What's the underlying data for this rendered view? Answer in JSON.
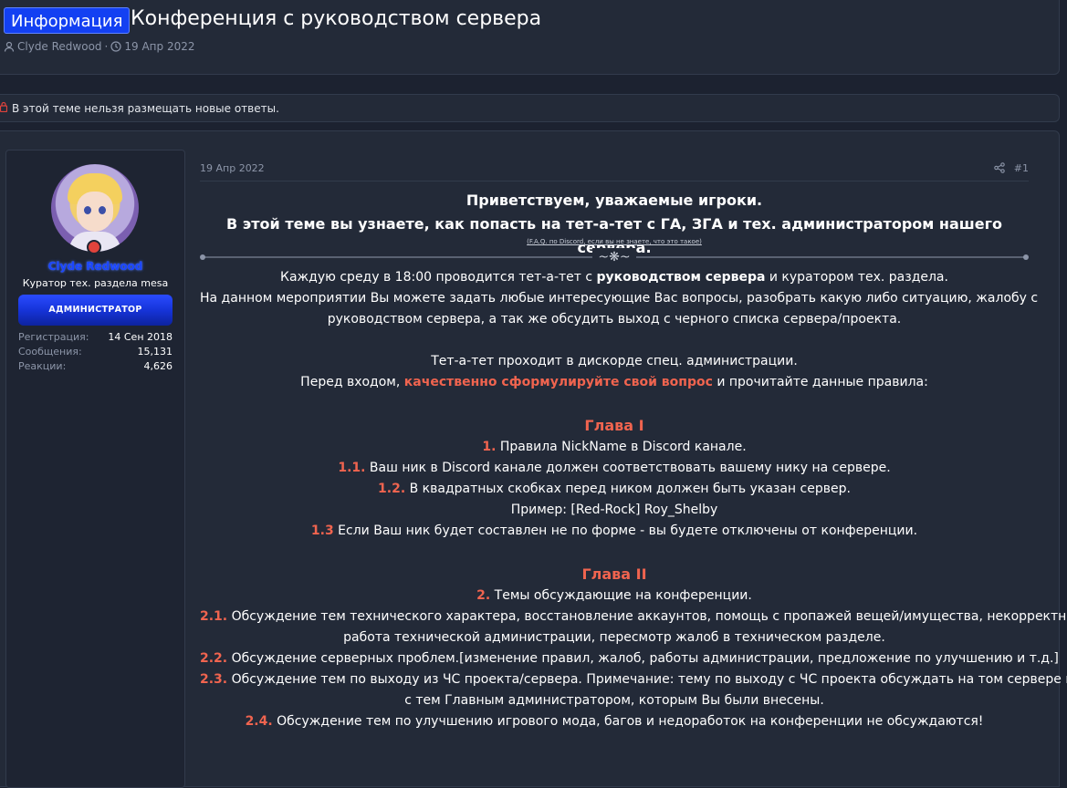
{
  "thread": {
    "prefix": "Информация",
    "title": "Конференция с руководством сервера",
    "author": "Clyde Redwood",
    "date": "19 Апр 2022"
  },
  "notice": {
    "text": "В этой теме нельзя размещать новые ответы."
  },
  "user": {
    "name": "Clyde Redwood",
    "title": "Куратор тех. раздела mesa",
    "banner": "АДМИНИСТРАТОР",
    "stats": [
      {
        "label": "Регистрация:",
        "value": "14 Сен 2018"
      },
      {
        "label": "Сообщения:",
        "value": "15,131"
      },
      {
        "label": "Реакции:",
        "value": "4,626"
      }
    ]
  },
  "post": {
    "date": "19 Апр 2022",
    "number": "#1",
    "greeting": "Приветствуем, уважаемые игроки.",
    "intro": "В этой теме вы узнаете, как попасть на тет-а-тет с ГА, ЗГА и тех. администратором нашего сервера.",
    "faq_link": "(F.A.Q. по Discord, если вы не знаете, что это такое)",
    "p1_a": "Каждую среду в 18:00 проводится тет-а-тет с ",
    "p1_b": "руководством сервера",
    "p1_c": " и куратором тех. раздела.",
    "p2": "На данном мероприятии Вы можете задать любые интересующие Вас вопросы, разобрать какую либо ситуацию, жалобу с",
    "p3": "руководством сервера, а так же обсудить выход с черного списка сервера/проекта.",
    "p4": "Тет-а-тет проходит в дискорде спец. администрации.",
    "p5_a": "Перед входом, ",
    "p5_b": "качественно сформулируйте свой вопрос",
    "p5_c": " и прочитайте данные правила:",
    "chapter1": "Глава I",
    "c1_1_num": "1.",
    "c1_1": " Правила NickName в Discord канале.",
    "c1_2_num": "1.1.",
    "c1_2": " Ваш ник в Discord канале должен соответствовать вашему нику на сервере.",
    "c1_3_num": "1.2.",
    "c1_3": " В квадратных скобках перед ником должен быть указан сервер.",
    "c1_4": "Пример: [Red-Rock] Roy_Shelby",
    "c1_5_num": "1.3",
    "c1_5": " Если Ваш ник будет составлен не по форме - вы будете отключены от конференции.",
    "chapter2": "Глава II",
    "c2_1_num": "2.",
    "c2_1": " Темы обсуждающие на конференции.",
    "c2_2_num": "2.1.",
    "c2_2": " Обсуждение тем технического характера, восстановление аккаунтов, помощь с пропажей вещей/имущества, некорректная",
    "c2_3": "работа технической администрации, пересмотр жалоб в техническом разделе.",
    "c2_4_num": "2.2.",
    "c2_4": " Обсуждение серверных проблем.[изменение правил, жалоб, работы администрации, предложение по улучшению и т.д.]",
    "c2_5_num": "2.3.",
    "c2_5": " Обсуждение тем по выходу из ЧС проекта/сервера. Примечание: тему по выходу с ЧС проекта обсуждать на том сервере и",
    "c2_6": "с тем Главным администратором, которым Вы были внесены.",
    "c2_7_num": "2.4.",
    "c2_7": " Обсуждение тем по улучшению игрового мода, багов и недоработок на конференции не обсуждаются!"
  },
  "icons": {
    "author": "user-icon",
    "date": "clock-icon",
    "notice": "lock-icon",
    "share": "share-icon",
    "ornament": "ornament-icon"
  },
  "colors": {
    "prefix_bg": "#1340f2",
    "username": "#1a45ff",
    "accent_red": "#f0644f",
    "banner": "#1634d9"
  }
}
